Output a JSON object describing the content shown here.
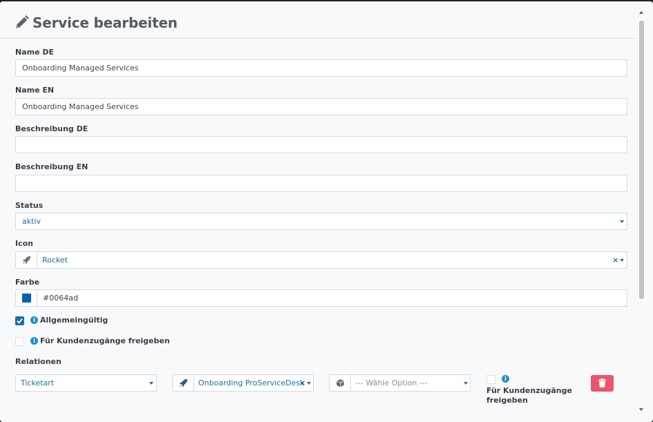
{
  "header": {
    "title": "Service bearbeiten",
    "icon": "pencil-icon"
  },
  "fields": {
    "name_de": {
      "label": "Name DE",
      "value": "Onboarding Managed Services"
    },
    "name_en": {
      "label": "Name EN",
      "value": "Onboarding Managed Services"
    },
    "desc_de": {
      "label": "Beschreibung DE",
      "value": ""
    },
    "desc_en": {
      "label": "Beschreibung EN",
      "value": ""
    },
    "status": {
      "label": "Status",
      "value": "aktiv"
    },
    "icon": {
      "label": "Icon",
      "value": "Rocket",
      "clear": "×"
    },
    "color": {
      "label": "Farbe",
      "value": "#0064ad",
      "swatch": "#0064ad"
    }
  },
  "checks": {
    "general": {
      "label": "Allgemeingültig",
      "checked": true
    },
    "customer": {
      "label": "Für Kundenzugänge freigeben",
      "checked": false
    }
  },
  "relations": {
    "label": "Relationen",
    "type": "Ticketart",
    "project": "Onboarding ProServiceDesk",
    "project_clear": "×",
    "option_placeholder": "--- Wähle Option ---",
    "customer_line1": "Für Kundenzugänge",
    "customer_line2": "freigeben"
  },
  "colors": {
    "accent": "#1e6fa8",
    "danger": "#e9566b",
    "info": "#1e8fc6"
  }
}
